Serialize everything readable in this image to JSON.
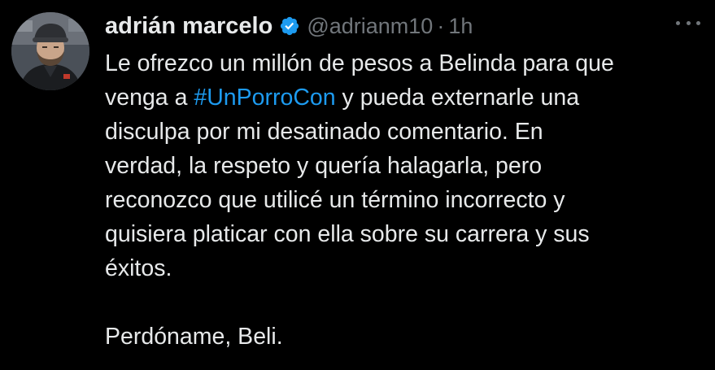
{
  "tweet": {
    "author": {
      "display_name": "adrián marcelo",
      "handle": "@adrianm10",
      "verified_icon": "verified-badge-icon",
      "avatar_icon": "avatar-photo"
    },
    "separator": "·",
    "time": "1h",
    "more_icon": "more-options-icon",
    "text": {
      "line1": "Le ofrezco un millón de pesos a Belinda para que",
      "line2_pre": "venga a ",
      "hashtag": "#UnPorroCon",
      "line2_post": " y pueda externarle una",
      "line3": "disculpa por mi desatinado comentario. En",
      "line4": "verdad, la respeto y quería halagarla, pero",
      "line5": "reconozco que utilicé un término incorrecto y",
      "line6": "quisiera platicar con ella sobre su carrera y sus",
      "line7": "éxitos.",
      "signoff": "Perdóname, Beli."
    },
    "colors": {
      "background": "#000000",
      "text": "#e7e9ea",
      "secondary": "#71767b",
      "link": "#1d9bf0",
      "verified": "#1d9bf0"
    }
  }
}
